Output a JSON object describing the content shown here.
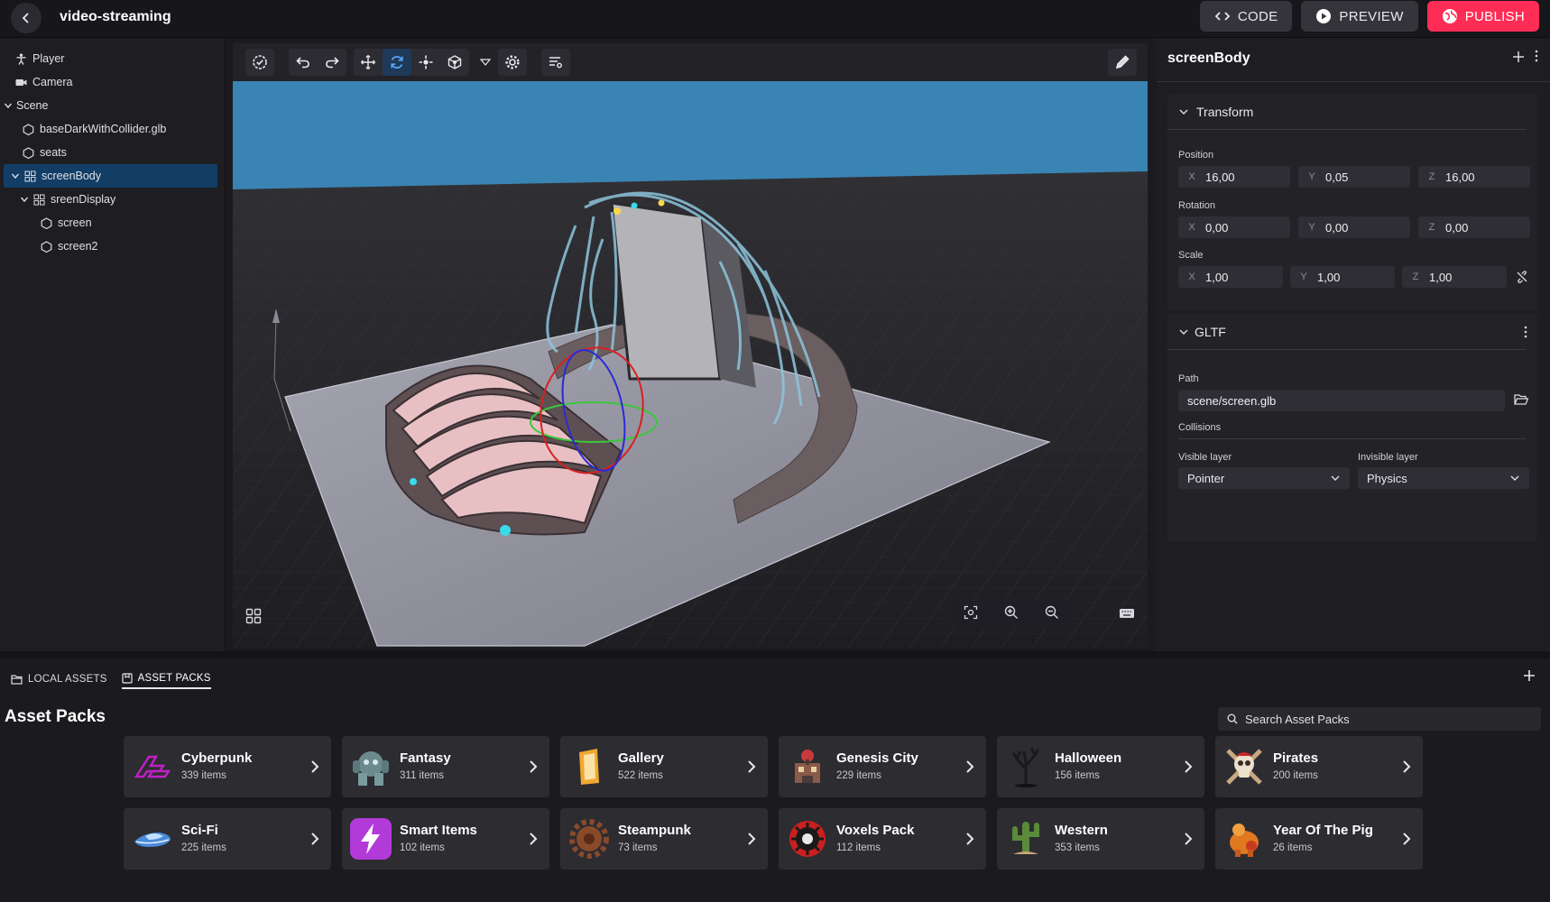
{
  "header": {
    "project_title": "video-streaming",
    "code_label": "CODE",
    "preview_label": "PREVIEW",
    "publish_label": "PUBLISH"
  },
  "hierarchy": {
    "items": [
      {
        "label": "Player"
      },
      {
        "label": "Camera"
      },
      {
        "label": "Scene"
      },
      {
        "label": "baseDarkWithCollider.glb"
      },
      {
        "label": "seats"
      },
      {
        "label": "screenBody"
      },
      {
        "label": "sreenDisplay"
      },
      {
        "label": "screen"
      },
      {
        "label": "screen2"
      }
    ],
    "selected": "screenBody"
  },
  "inspector": {
    "entity_name": "screenBody",
    "transform": {
      "title": "Transform",
      "position_label": "Position",
      "rotation_label": "Rotation",
      "scale_label": "Scale",
      "position": {
        "x": "16,00",
        "y": "0,05",
        "z": "16,00"
      },
      "rotation": {
        "x": "0,00",
        "y": "0,00",
        "z": "0,00"
      },
      "scale": {
        "x": "1,00",
        "y": "1,00",
        "z": "1,00"
      },
      "axis_x": "X",
      "axis_y": "Y",
      "axis_z": "Z"
    },
    "gltf": {
      "title": "GLTF",
      "path_label": "Path",
      "path_value": "scene/screen.glb",
      "collisions_label": "Collisions",
      "visible_layer_label": "Visible layer",
      "visible_layer_value": "Pointer",
      "invisible_layer_label": "Invisible layer",
      "invisible_layer_value": "Physics"
    }
  },
  "assets": {
    "tabs": [
      {
        "label": "LOCAL ASSETS"
      },
      {
        "label": "ASSET PACKS"
      }
    ],
    "title": "Asset Packs",
    "search_placeholder": "Search Asset Packs",
    "packs": [
      {
        "name": "Cyberpunk",
        "count": "339 items",
        "icon": "cyberpunk-logo-icon",
        "color": "#b01ab8"
      },
      {
        "name": "Fantasy",
        "count": "311 items",
        "icon": "fantasy-golem-icon",
        "color": "#6a8a8e"
      },
      {
        "name": "Gallery",
        "count": "522 items",
        "icon": "gallery-frame-icon",
        "color": "#f0a830"
      },
      {
        "name": "Genesis City",
        "count": "229 items",
        "icon": "genesis-city-icon",
        "color": "#8a5a4a"
      },
      {
        "name": "Halloween",
        "count": "156 items",
        "icon": "halloween-tree-icon",
        "color": "#2a2a2a"
      },
      {
        "name": "Pirates",
        "count": "200 items",
        "icon": "pirates-skull-icon",
        "color": "#d8c0a0"
      },
      {
        "name": "Sci-Fi",
        "count": "225 items",
        "icon": "scifi-ship-icon",
        "color": "#4a8ad8"
      },
      {
        "name": "Smart Items",
        "count": "102 items",
        "icon": "smart-items-bolt-icon",
        "color": "#b23ad8"
      },
      {
        "name": "Steampunk",
        "count": "73 items",
        "icon": "steampunk-gear-icon",
        "color": "#8a4a2a"
      },
      {
        "name": "Voxels Pack",
        "count": "112 items",
        "icon": "voxels-icon",
        "color": "#c82020"
      },
      {
        "name": "Western",
        "count": "353 items",
        "icon": "western-cactus-icon",
        "color": "#5a8a3a"
      },
      {
        "name": "Year Of The Pig",
        "count": "26 items",
        "icon": "year-of-pig-icon",
        "color": "#e07820"
      }
    ]
  },
  "colors": {
    "publish": "#ff2d55",
    "selection": "#123e66",
    "sky": "#3a84b4"
  }
}
